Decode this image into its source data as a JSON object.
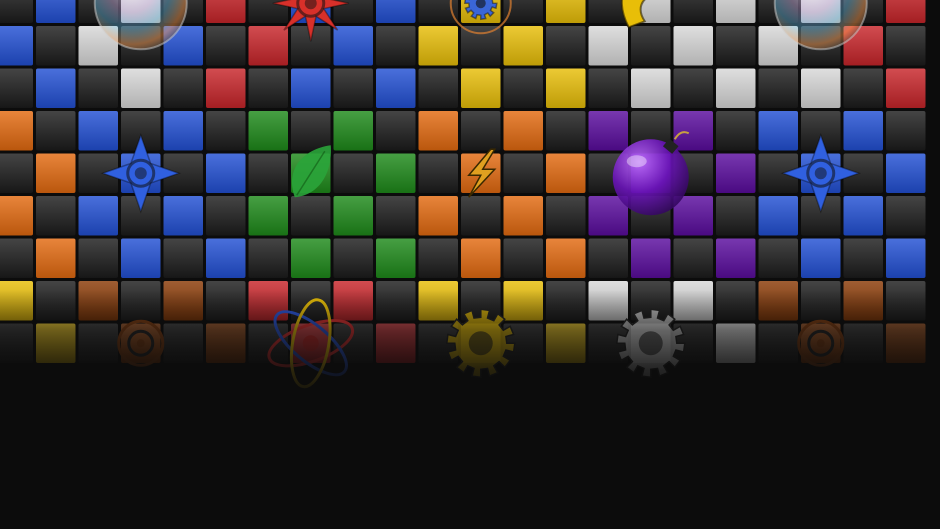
{
  "board": {
    "columns": 22,
    "rows": 9,
    "cell_colors": {
      "0": "#1c1c1c",
      "r": "#c8252a",
      "b": "#2250d4",
      "w": "#d8d8d8",
      "y": "#e8be08",
      "o": "#e36a10",
      "g": "#1e8a1a",
      "p": "#5a0c9e",
      "n": "#8a3a06",
      "s": "#4a4a4a"
    },
    "cells": [
      "0b0w0r0b0b0y0y0w0w0w0r",
      "b0w0b0r0b0y0y0w0w0w0r0",
      "0b0w0r0b0b0y0y0w0w0w0r",
      "o0b0b0g0g0o0o0p0p0b0b0",
      "0o0b0b0g0g0o0o0p0p0b0b",
      "o0b0b0g0g0o0o0p0p0b0b0",
      "0o0b0b0g0g0o0o0p0p0b0b",
      "y0n0n0r0r0y0y0w0w0n0n0",
      "0y0n0n0r0r0y0y0w0w0n0n"
    ]
  },
  "pieces": [
    {
      "type": "bubble",
      "icon": "rainbow-bubble-icon",
      "col": 3,
      "row": 0
    },
    {
      "type": "star",
      "icon": "red-shuriken-icon",
      "col": 7,
      "row": 0,
      "color": "#d8302a"
    },
    {
      "type": "gear",
      "icon": "blue-gear-icon",
      "col": 11,
      "row": 0,
      "color": "#3a66d8"
    },
    {
      "type": "hook",
      "icon": "yellow-hook-icon",
      "col": 15,
      "row": 0,
      "color": "#e8be08"
    },
    {
      "type": "bubble",
      "icon": "rainbow-bubble-icon",
      "col": 19,
      "row": 0
    },
    {
      "type": "star",
      "icon": "blue-shuriken-icon",
      "col": 3,
      "row": 4,
      "color": "#3060e0"
    },
    {
      "type": "leaf",
      "icon": "green-leaf-icon",
      "col": 7,
      "row": 4,
      "color": "#2aa43a"
    },
    {
      "type": "bolt",
      "icon": "lightning-bolt-icon",
      "col": 11,
      "row": 4,
      "color": "#e0a020"
    },
    {
      "type": "bomb",
      "icon": "purple-bomb-icon",
      "col": 15,
      "row": 4,
      "color": "#6a14b8"
    },
    {
      "type": "star",
      "icon": "blue-shuriken-icon",
      "col": 19,
      "row": 4,
      "color": "#3060e0"
    },
    {
      "type": "target",
      "icon": "brown-target-icon",
      "col": 3,
      "row": 8,
      "color": "#7a3a10"
    },
    {
      "type": "atom",
      "icon": "rainbow-atom-icon",
      "col": 7,
      "row": 8
    },
    {
      "type": "cog",
      "icon": "yellow-cog-icon",
      "col": 11,
      "row": 8,
      "color": "#e8be08"
    },
    {
      "type": "cog",
      "icon": "white-cog-icon",
      "col": 15,
      "row": 8,
      "color": "#d0d0d0"
    },
    {
      "type": "target",
      "icon": "brown-target-icon",
      "col": 19,
      "row": 8,
      "color": "#7a3a10"
    }
  ]
}
